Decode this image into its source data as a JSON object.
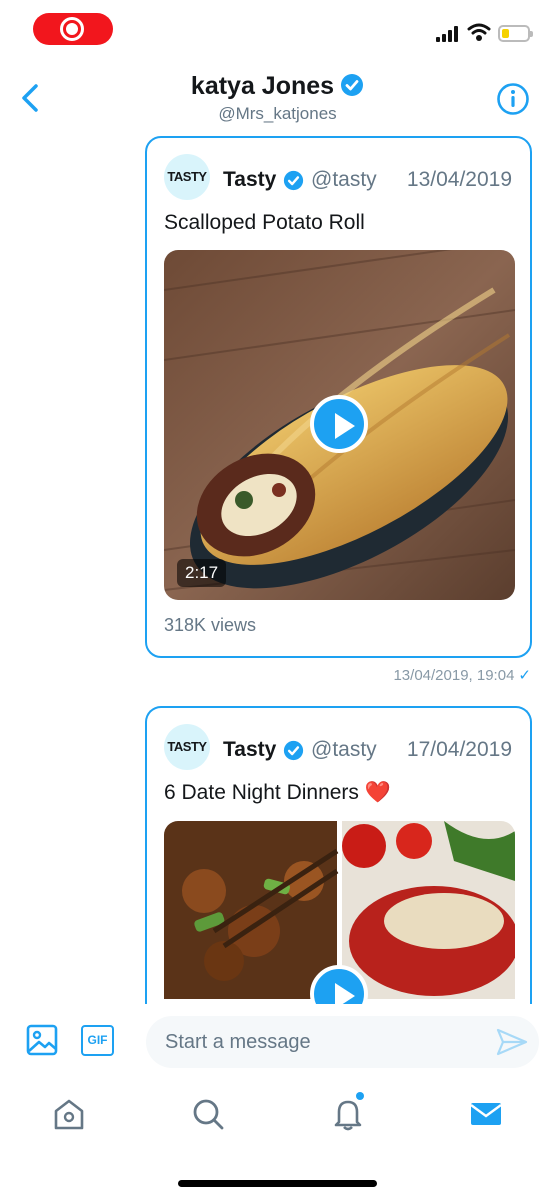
{
  "status_bar": {
    "recording": true
  },
  "header": {
    "name": "katya Jones",
    "handle": "@Mrs_katjones",
    "verified": true,
    "back_icon": "chevron-left-icon",
    "info_icon": "info-icon"
  },
  "messages": [
    {
      "author": "Tasty",
      "avatar_text": "TASTY",
      "handle": "@tasty",
      "date": "13/04/2019",
      "caption": "Scalloped Potato Roll",
      "duration": "2:17",
      "views": "318K views",
      "sent_time": "13/04/2019, 19:04",
      "read_mark": "✓"
    },
    {
      "author": "Tasty",
      "avatar_text": "TASTY",
      "handle": "@tasty",
      "date": "17/04/2019",
      "caption": "6 Date Night Dinners ❤️"
    }
  ],
  "composer": {
    "placeholder": "Start a message",
    "gif_label": "GIF"
  },
  "tabs": [
    {
      "name": "home",
      "icon": "home-icon"
    },
    {
      "name": "search",
      "icon": "search-icon"
    },
    {
      "name": "notifications",
      "icon": "bell-icon",
      "has_badge": true
    },
    {
      "name": "messages",
      "icon": "mail-icon",
      "active": true
    }
  ],
  "colors": {
    "accent": "#1da1f2",
    "secondary_text": "#657786",
    "record": "#f2161d"
  }
}
